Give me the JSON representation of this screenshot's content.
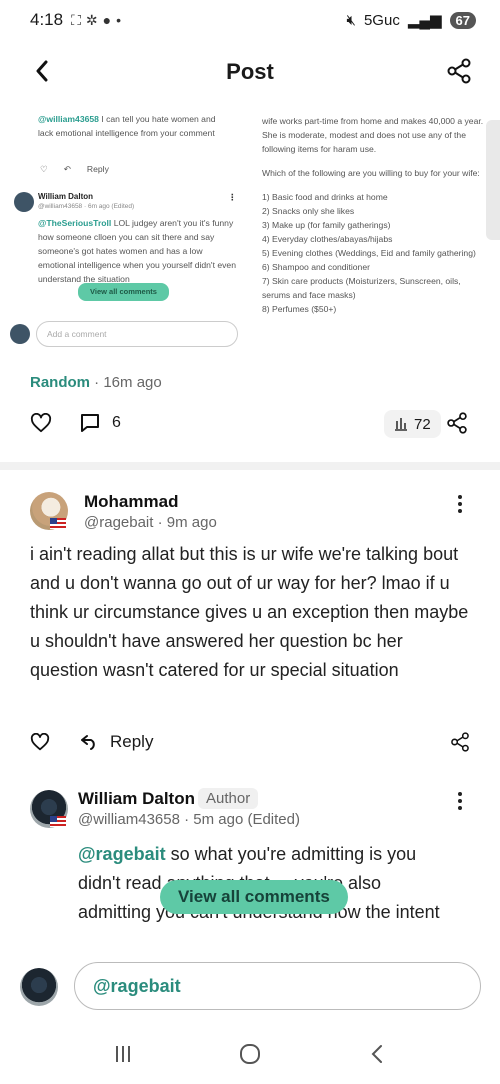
{
  "status_bar": {
    "time": "4:18",
    "network": "5Guc",
    "battery": "67"
  },
  "app_bar": {
    "title": "Post"
  },
  "embedded_screenshot": {
    "comment1_mention": "@william43658",
    "comment1_text": " I can tell you hate women and lack emotional intelligence from your comment",
    "comment1_reply_label": "Reply",
    "comment2_author": "William Dalton",
    "comment2_handle": "@william43658 · 6m ago (Edited)",
    "comment2_mention": "@TheSeriousTroll",
    "comment2_text": " LOL judgey  aren't you it's funny how someone clloen you can sit there and say someone's got hates women and has a low emotional intelligence when you yourself didn't even understand the situation",
    "view_all_label": "View all comments",
    "add_comment_placeholder": "Add a comment",
    "right_intro": "wife works part-time from home and makes 40,000 a year. She is moderate, modest and does not use any of the following items for haram use.",
    "right_question": "Which of the following are you willing to buy for your wife:",
    "right_items": [
      "1) Basic food and drinks at home",
      "2) Snacks only she likes",
      "3) Make up (for family gatherings)",
      "4) Everyday clothes/abayas/hijabs",
      "5) Evening clothes (Weddings, Eid and family gathering)",
      "6) Shampoo and conditioner",
      "7) Skin care products (Moisturizers, Sunscreen, oils, serums and face masks)",
      "8) Perfumes ($50+)"
    ]
  },
  "post_meta": {
    "category": "Random",
    "separator": " · ",
    "time": "16m ago"
  },
  "post_actions": {
    "comment_count": "6",
    "view_count": "72"
  },
  "comment": {
    "name": "Mohammad",
    "handle": "@ragebait · 9m ago",
    "body": "i ain't reading allat but this is ur wife we're talking bout and u don't wanna go out of ur way for her? lmao if u think ur circumstance gives u an exception then maybe u shouldn't have answered her question bc her question wasn't catered for ur special situation",
    "reply_label": "Reply"
  },
  "reply": {
    "name": "William Dalton",
    "badge": "Author",
    "handle": "@william43658 · 5m ago (Edited)",
    "mention": "@ragebait",
    "body": " so what you're admitting is you didn't read anything that ... you're also admitting you can't understand how the intent and whether ... of",
    "view_all_label": "View all comments"
  },
  "reply_input": {
    "value": "@ragebait"
  },
  "colors": {
    "accent": "#2b8c7d",
    "pill": "#5ec9a6"
  }
}
